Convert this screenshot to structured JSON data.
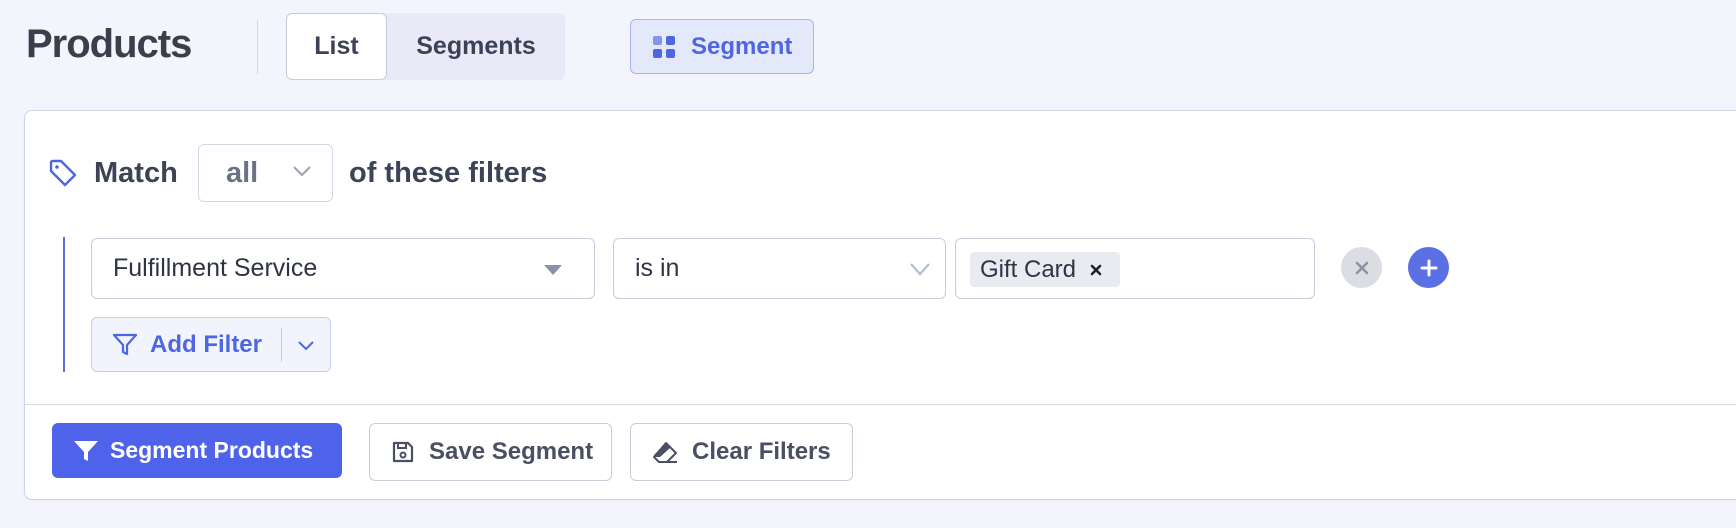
{
  "header": {
    "title": "Products",
    "tabs": [
      {
        "label": "List",
        "active": true
      },
      {
        "label": "Segments",
        "active": false
      }
    ],
    "segment_button": {
      "label": "Segment",
      "icon": "grid-icon"
    }
  },
  "filter_panel": {
    "match_prefix": "Match",
    "match_mode": "all",
    "match_suffix": "of these filters",
    "rows": [
      {
        "field": "Fulfillment Service",
        "operator": "is in",
        "values": [
          "Gift Card"
        ]
      }
    ],
    "add_filter_label": "Add Filter"
  },
  "actions": {
    "segment_label": "Segment Products",
    "save_label": "Save Segment",
    "clear_label": "Clear Filters"
  },
  "colors": {
    "accent": "#4f63ea",
    "background": "#f4f4fd",
    "text": "#3d4356"
  }
}
